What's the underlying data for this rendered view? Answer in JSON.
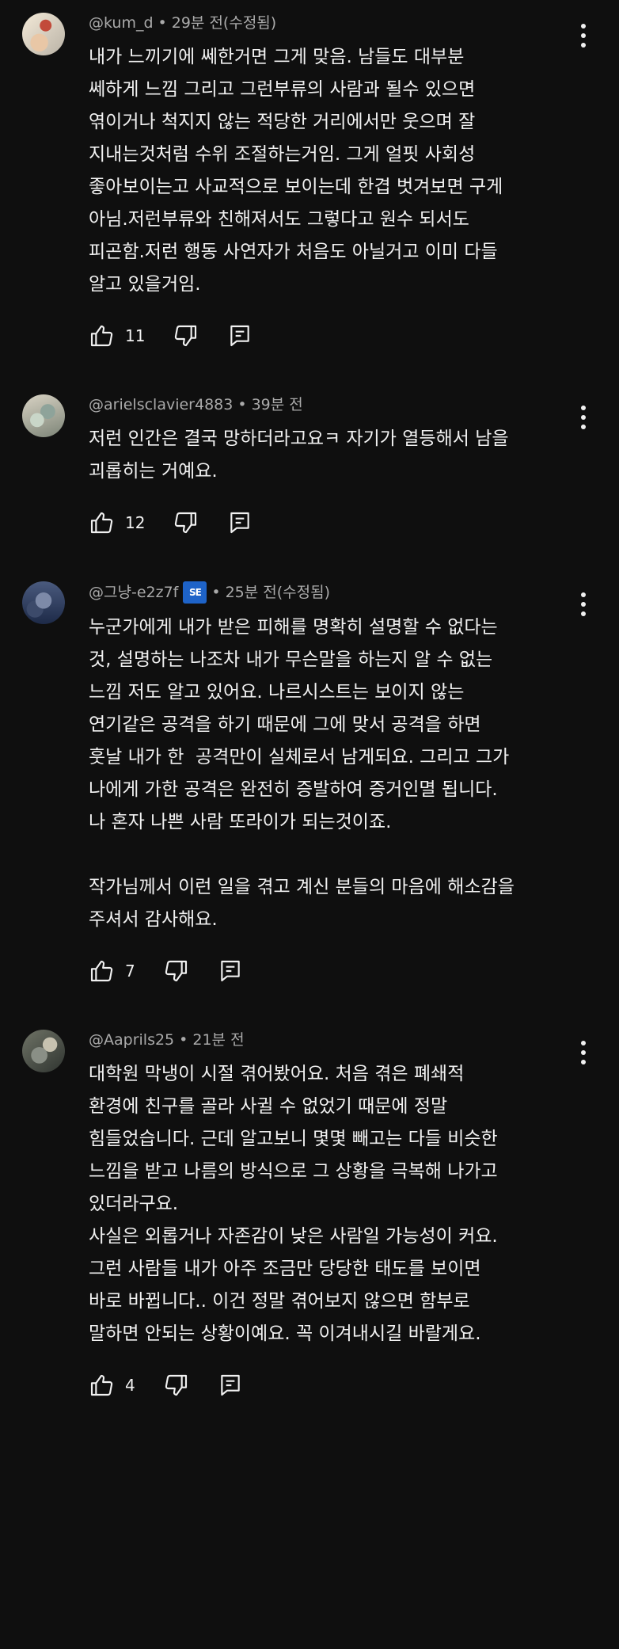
{
  "comments": [
    {
      "handle": "@kum_d",
      "time": "29분 전(수정됨)",
      "text": "내가 느끼기에 쎄한거면 그게 맞음. 남들도 대부분\n쎄하게 느낌 그리고 그런부류의 사람과 될수 있으면\n엮이거나 척지지 않는 적당한 거리에서만 웃으며 잘\n지내는것처럼 수위 조절하는거임. 그게 얼핏 사회성\n좋아보이는고 사교적으로 보이는데 한겹 벗겨보면 구게\n아님.저런부류와 친해져서도 그렇다고 원수 되서도\n피곤함.저런 행동 사연자가 처음도 아닐거고 이미 다들\n알고 있을거임.",
      "likes": "11"
    },
    {
      "handle": "@arielsclavier4883",
      "time": "39분 전",
      "text": "저런 인간은 결국 망하더라고요ㅋ 자기가 열등해서 남을\n괴롭히는 거예요.",
      "likes": "12"
    },
    {
      "handle": "@그냥-e2z7f",
      "badge": "SE",
      "time": "25분 전(수정됨)",
      "text": "누군가에게 내가 받은 피해를 명확히 설명할 수 없다는\n것, 설명하는 나조차 내가 무슨말을 하는지 알 수 없는\n느낌 저도 알고 있어요. 나르시스트는 보이지 않는\n연기같은 공격을 하기 때문에 그에 맞서 공격을 하면\n훗날 내가 한  공격만이 실체로서 남게되요. 그리고 그가\n나에게 가한 공격은 완전히 증발하여 증거인멸 됩니다.\n나 혼자 나쁜 사람 또라이가 되는것이죠.\n\n작가님께서 이런 일을 겪고 계신 분들의 마음에 해소감을\n주셔서 감사해요.",
      "likes": "7"
    },
    {
      "handle": "@Aaprils25",
      "time": "21분 전",
      "text": "대학원 막냉이 시절 겪어봤어요. 처음 겪은 폐쇄적\n환경에 친구를 골라 사귈 수 없었기 때문에 정말\n힘들었습니다. 근데 알고보니 몇몇 빼고는 다들 비슷한\n느낌을 받고 나름의 방식으로 그 상황을 극복해 나가고\n있더라구요.\n사실은 외롭거나 자존감이 낮은 사람일 가능성이 커요.\n그런 사람들 내가 아주 조금만 당당한 태도를 보이면\n바로 바뀝니다.. 이건 정말 겪어보지 않으면 함부로\n말하면 안되는 상황이예요. 꼭 이겨내시길 바랄게요.",
      "likes": "4"
    }
  ],
  "icons": {
    "like": "thumb-up-icon",
    "dislike": "thumb-down-icon",
    "reply": "reply-comment-icon",
    "more": "more-vertical-icon"
  },
  "colors": {
    "background": "#0f0f0f",
    "text": "#f1f1f1",
    "meta": "#aaaaaa"
  }
}
